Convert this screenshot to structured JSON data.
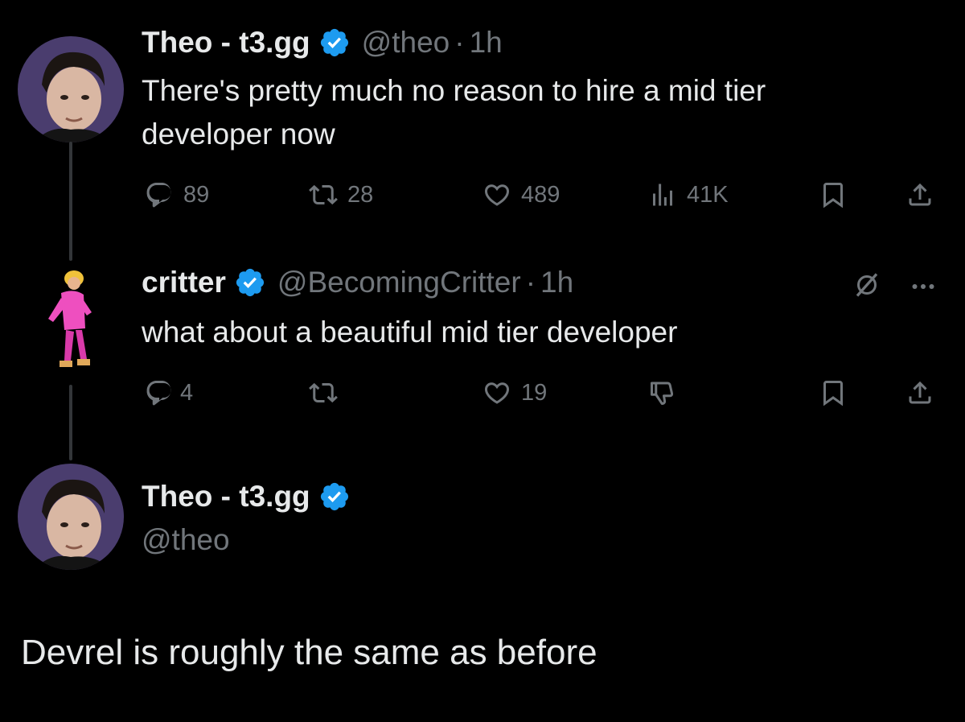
{
  "tweet1": {
    "name": "Theo - t3.gg",
    "handle": "@theo",
    "dot": "·",
    "time": "1h",
    "text_line1": "There's pretty much no reason to hire a mid tier",
    "text_line2": "developer now",
    "replies": "89",
    "reposts": "28",
    "likes": "489",
    "views": "41K"
  },
  "tweet2": {
    "name": "critter",
    "handle": "@BecomingCritter",
    "dot": "·",
    "time": "1h",
    "text": "what about a beautiful mid tier developer",
    "replies": "4",
    "likes": "19"
  },
  "tweet3": {
    "name": "Theo - t3.gg",
    "handle": "@theo",
    "text": "Devrel is roughly the same as before"
  },
  "colors": {
    "background": "#000000",
    "text": "#e7e9ea",
    "muted": "#71767b",
    "verified": "#1d9bf0",
    "thread_line": "#333639"
  },
  "icons": [
    "reply-icon",
    "repost-icon",
    "like-icon",
    "views-icon",
    "bookmark-icon",
    "share-icon",
    "grok-icon",
    "more-icon",
    "dislike-icon",
    "verified-icon"
  ]
}
